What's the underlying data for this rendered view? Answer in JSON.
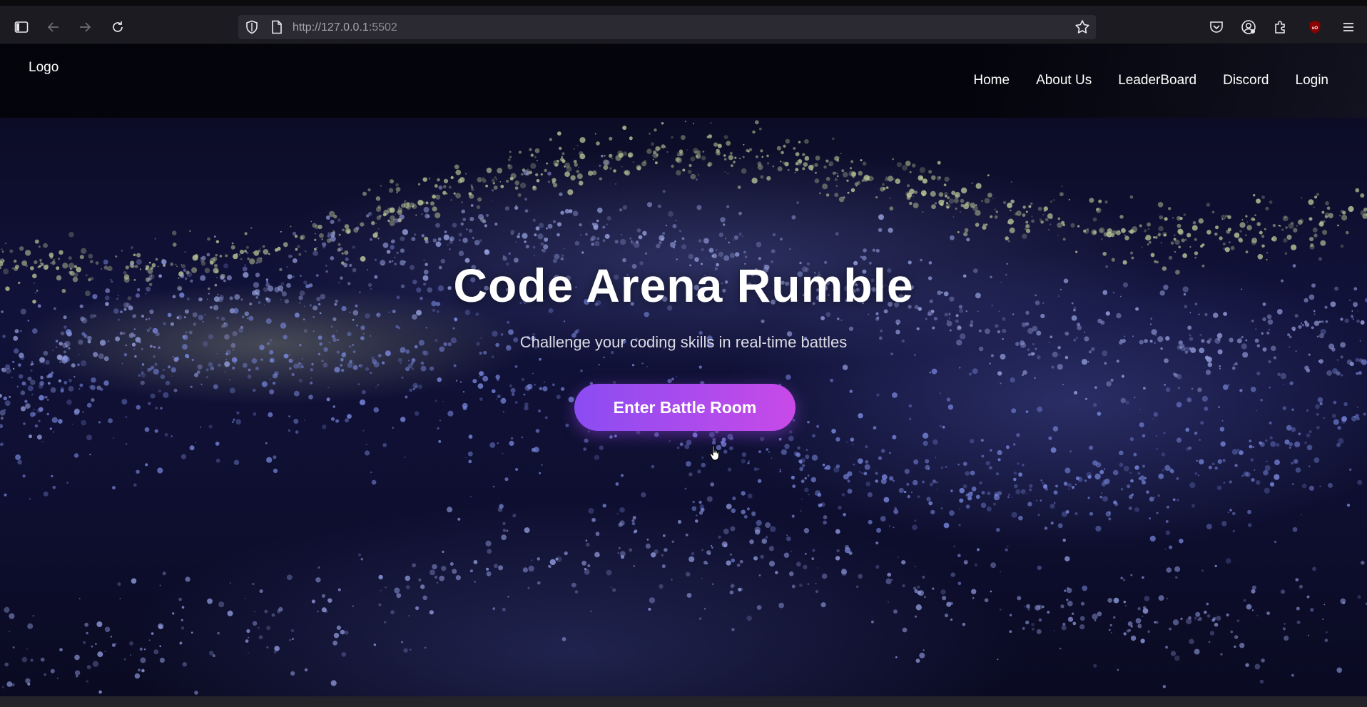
{
  "browser": {
    "url_host": "http://127.0.0.1:",
    "url_port": "5502",
    "icons": [
      "sidebar-icon",
      "back-arrow-icon",
      "forward-arrow-icon",
      "reload-icon",
      "shield-icon",
      "page-icon",
      "bookmark-star-icon",
      "pocket-icon",
      "account-icon",
      "extensions-icon",
      "ublock-icon",
      "menu-icon"
    ]
  },
  "nav": {
    "logo": "Logo",
    "links": [
      "Home",
      "About Us",
      "LeaderBoard",
      "Discord",
      "Login"
    ]
  },
  "hero": {
    "title": "Code Arena Rumble",
    "subtitle": "Challenge your coding skills in real-time battles",
    "cta_label": "Enter Battle Room"
  },
  "colors": {
    "cta_start": "#8b4cf2",
    "cta_end": "#c84ae8",
    "background": "#0b0b1c"
  }
}
